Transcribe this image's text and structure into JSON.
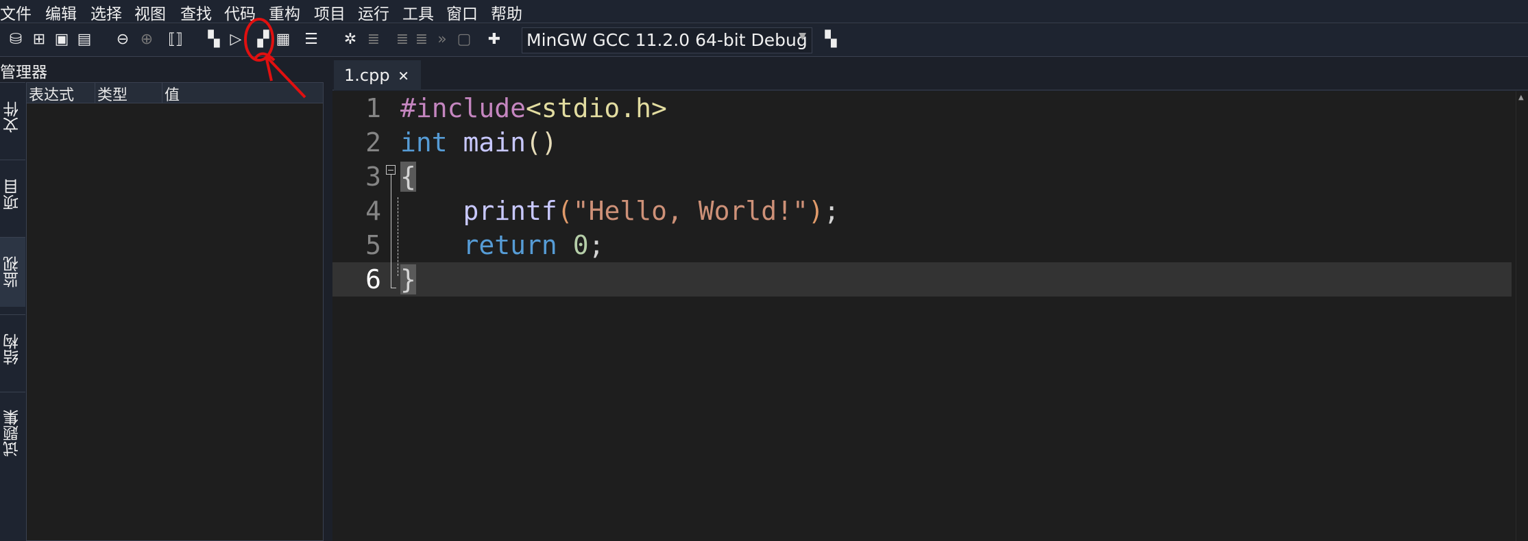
{
  "menu": [
    "文件",
    "编辑",
    "选择",
    "视图",
    "查找",
    "代码",
    "重构",
    "项目",
    "运行",
    "工具",
    "窗口",
    "帮助"
  ],
  "toolbar": {
    "compiler": "MinGW GCC 11.2.0 64-bit Debug"
  },
  "panel": {
    "title": "管理器",
    "tabs": [
      "文件",
      "项目",
      "监视",
      "结构",
      "试题集"
    ],
    "active_tab": "监视",
    "columns": [
      "表达式",
      "类型",
      "值"
    ]
  },
  "editor": {
    "tab": "1.cpp",
    "tab_close": "✕",
    "line_numbers": [
      "1",
      "2",
      "3",
      "4",
      "5",
      "6"
    ],
    "lines": [
      [
        {
          "t": "#include",
          "c": "#c586c0"
        },
        {
          "t": "<stdio.h>",
          "c": "#e2dca0"
        }
      ],
      [
        {
          "t": "int",
          "c": "#569cd6"
        },
        {
          "t": " ",
          "c": "#d4d4d4"
        },
        {
          "t": "main",
          "c": "#c8c8ff"
        },
        {
          "t": "()",
          "c": "#e6dcb8"
        }
      ],
      [
        {
          "t": "{",
          "c": "#d4d4d4",
          "brace": true
        }
      ],
      [
        {
          "t": "    ",
          "c": "#d4d4d4"
        },
        {
          "t": "printf",
          "c": "#c8c8ff"
        },
        {
          "t": "(",
          "c": "#e09a6a"
        },
        {
          "t": "\"Hello, World!\"",
          "c": "#ce9178"
        },
        {
          "t": ")",
          "c": "#e09a6a"
        },
        {
          "t": ";",
          "c": "#d4d4d4"
        }
      ],
      [
        {
          "t": "    ",
          "c": "#d4d4d4"
        },
        {
          "t": "return",
          "c": "#569cd6"
        },
        {
          "t": " ",
          "c": "#d4d4d4"
        },
        {
          "t": "0",
          "c": "#b5cea8"
        },
        {
          "t": ";",
          "c": "#d4d4d4"
        }
      ],
      [
        {
          "t": "}",
          "c": "#d4d4d4",
          "brace": true
        }
      ]
    ],
    "current_line": 6
  },
  "colors": {
    "annotation": "#e01010",
    "background": "#1e1e1e"
  }
}
